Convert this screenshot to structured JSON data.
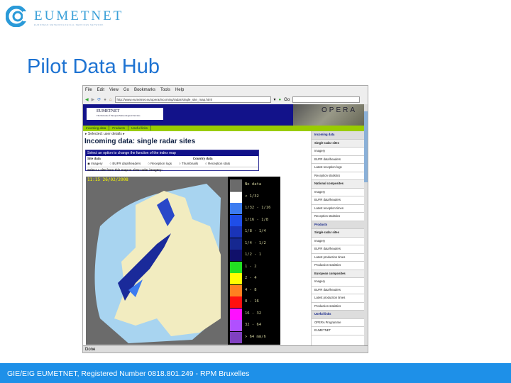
{
  "logo": {
    "name": "EUMETNET",
    "tagline": "EUROPEAN METEOROLOGICAL SERVICES NETWORK"
  },
  "title": "Pilot Data Hub",
  "browser": {
    "menu": [
      "File",
      "Edit",
      "View",
      "Go",
      "Bookmarks",
      "Tools",
      "Help"
    ],
    "url": "http://www.eumetnet.eu/opera/incoming/radar/single_site_map.html",
    "go_label": "Go",
    "status": "Done"
  },
  "site": {
    "banner_logo": "EUMETNET",
    "banner_logo_sub": "The Network of European Meteorological Services",
    "banner_right": "OPERA",
    "nav": [
      "Incoming data",
      "Products",
      "Useful links"
    ],
    "breadcrumb": "▸ Selected: user details ▸",
    "heading": "Incoming data: single radar sites",
    "selector": {
      "header": "Select an option to change the function of the index map",
      "site_data_label": "Site data",
      "site_options": [
        "Imagery",
        "BUFR data/headers",
        "Reception logs"
      ],
      "country_label": "Country data",
      "country_options": [
        "Thumbnails",
        "Reception stats"
      ],
      "instruction": "Select a site from this map to view radar imagery:"
    },
    "map_timestamp": "11:15 26/02/2008",
    "legend": [
      {
        "label": "No data",
        "color": "#6b6b6b"
      },
      {
        "label": "< 1/32",
        "color": "#ffffff"
      },
      {
        "label": "1/32 - 1/16",
        "color": "#3d7cf0"
      },
      {
        "label": "1/16 - 1/8",
        "color": "#1f4ee8"
      },
      {
        "label": "1/8 - 1/4",
        "color": "#1a34b8"
      },
      {
        "label": "1/4 - 1/2",
        "color": "#162890"
      },
      {
        "label": "1/2 - 1",
        "color": "#10106a"
      },
      {
        "label": "1 - 2",
        "color": "#22e022"
      },
      {
        "label": "2 - 4",
        "color": "#ffff00"
      },
      {
        "label": "4 - 8",
        "color": "#ff8020"
      },
      {
        "label": "8 - 16",
        "color": "#ff1010"
      },
      {
        "label": "16 - 32",
        "color": "#ff10ff"
      },
      {
        "label": "32 - 64",
        "color": "#b050ff"
      },
      {
        "label": "> 64 mm/h",
        "color": "#8040c0"
      }
    ],
    "sidebar": [
      {
        "label": "Incoming data",
        "kind": "h"
      },
      {
        "label": "Single radar sites",
        "kind": "s"
      },
      {
        "label": "Imagery",
        "kind": ""
      },
      {
        "label": "BUFR data/headers",
        "kind": ""
      },
      {
        "label": "Latest reception logs",
        "kind": ""
      },
      {
        "label": "Reception statistics",
        "kind": ""
      },
      {
        "label": "National composites",
        "kind": "s"
      },
      {
        "label": "Imagery",
        "kind": ""
      },
      {
        "label": "BUFR data/headers",
        "kind": ""
      },
      {
        "label": "Latest reception times",
        "kind": ""
      },
      {
        "label": "Reception statistics",
        "kind": ""
      },
      {
        "label": "Products",
        "kind": "h"
      },
      {
        "label": "Single radar sites",
        "kind": "s"
      },
      {
        "label": "Imagery",
        "kind": ""
      },
      {
        "label": "BUFR data/headers",
        "kind": ""
      },
      {
        "label": "Latest production times",
        "kind": ""
      },
      {
        "label": "Production statistics",
        "kind": ""
      },
      {
        "label": "European composites",
        "kind": "s"
      },
      {
        "label": "Imagery",
        "kind": ""
      },
      {
        "label": "BUFR data/headers",
        "kind": ""
      },
      {
        "label": "Latest production times",
        "kind": ""
      },
      {
        "label": "Production statistics",
        "kind": ""
      },
      {
        "label": "Useful links",
        "kind": "h"
      },
      {
        "label": "OPERA Programme",
        "kind": ""
      },
      {
        "label": "EUMETNET",
        "kind": ""
      }
    ]
  },
  "footer": "GIE/EIG EUMETNET, Registered Number 0818.801.249 - RPM Bruxelles"
}
